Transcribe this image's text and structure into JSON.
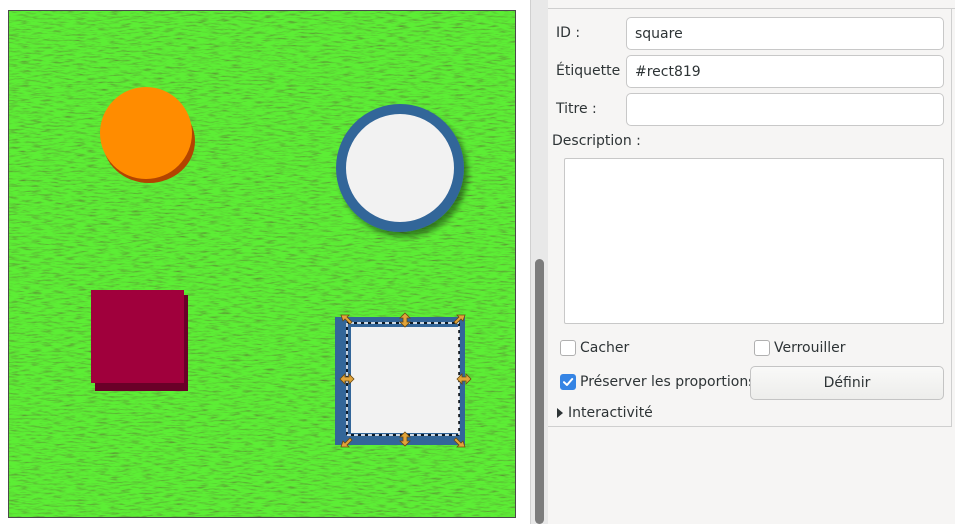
{
  "panel": {
    "id_label": "ID :",
    "id_value": "square",
    "label_label": "Étiquette :",
    "label_value": "#rect819",
    "title_label": "Titre :",
    "title_value": "",
    "description_label": "Description :",
    "description_value": "",
    "hide_label": "Cacher",
    "hide_checked": false,
    "lock_label": "Verrouiller",
    "lock_checked": false,
    "preserve_label": "Préserver les proportions",
    "preserve_checked": true,
    "set_button": "Définir",
    "interactivity_label": "Interactivité"
  },
  "canvas": {
    "background": "grass-texture",
    "shapes": [
      {
        "name": "orange-circle",
        "fill": "#ff8c00",
        "shadow": "#b34400"
      },
      {
        "name": "blue-ring-circle",
        "fill": "#f2f2f2",
        "stroke": "#336699"
      },
      {
        "name": "crimson-rectangle",
        "fill": "#a0003c",
        "shadow": "#6a0028"
      },
      {
        "name": "selected-square",
        "id": "square",
        "fill": "#f2f2f2",
        "stroke": "#336699"
      }
    ]
  },
  "colors": {
    "panel_bg": "#f6f5f4",
    "accent": "#3584e4",
    "grass": "#3f8f24",
    "selection_handle": "#e2a43a"
  }
}
